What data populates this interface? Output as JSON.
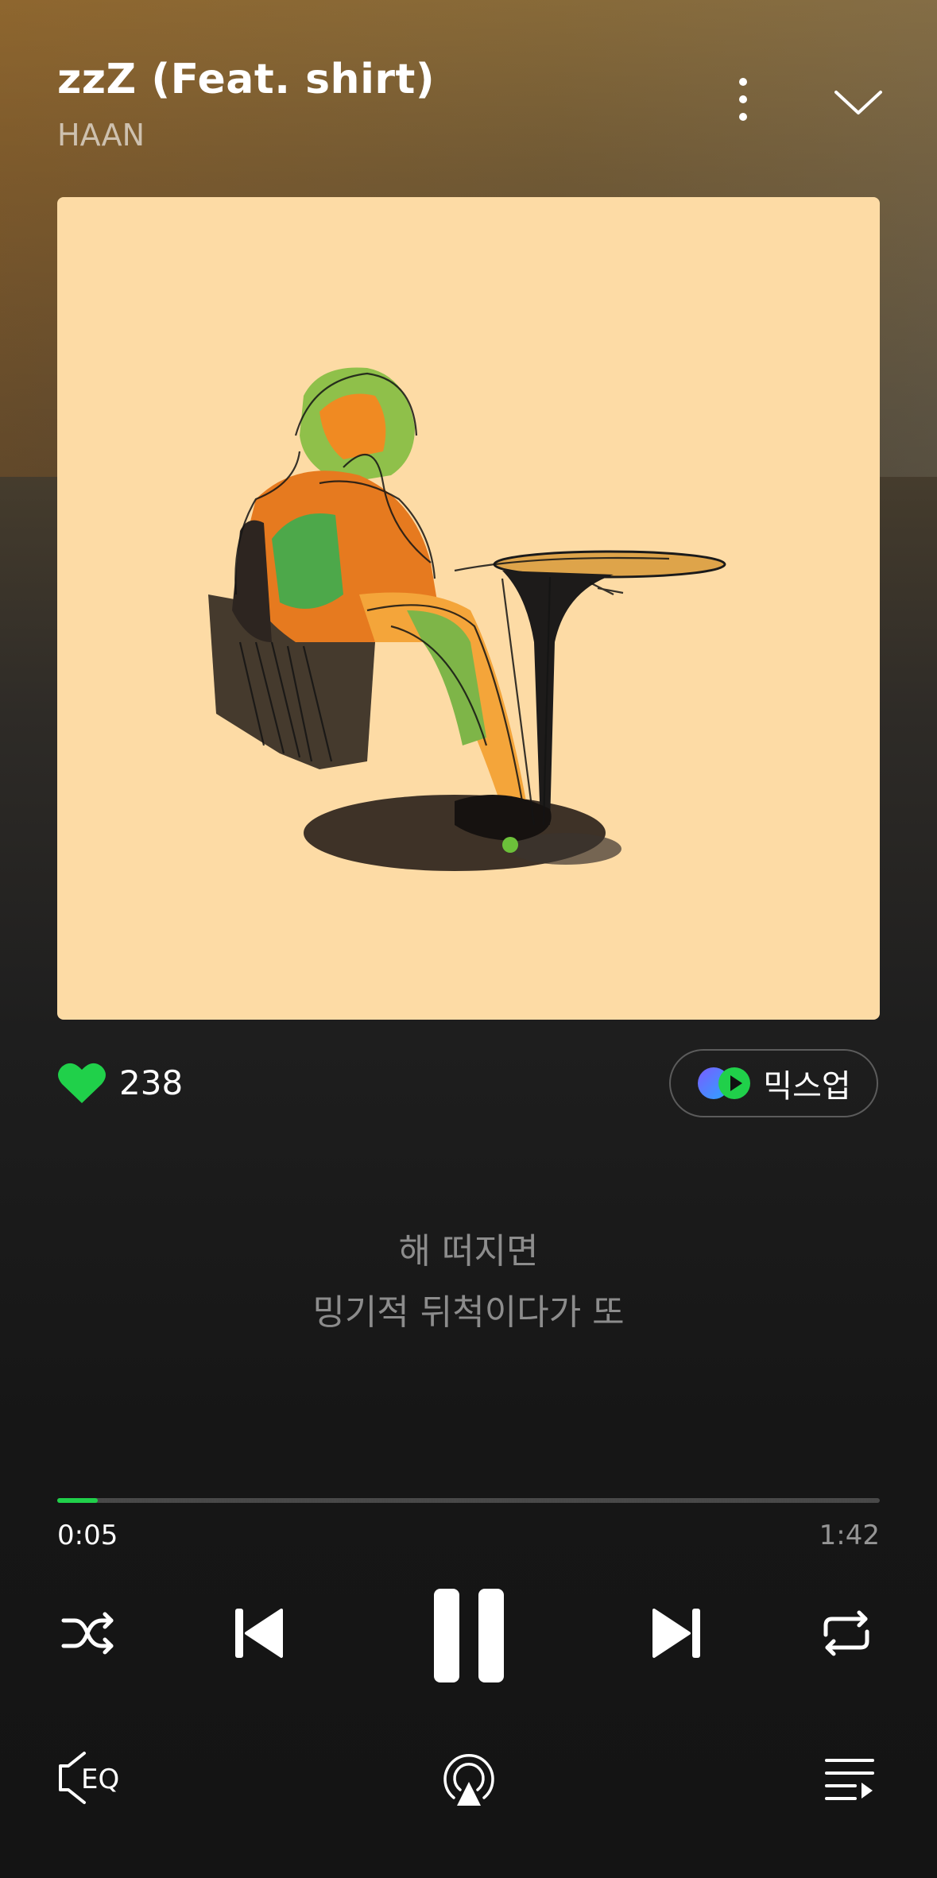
{
  "track": {
    "title": "zzZ (Feat. shirt)",
    "artist": "HAAN"
  },
  "like": {
    "count": "238",
    "color": "#20d04a"
  },
  "mixup": {
    "label": "믹스업"
  },
  "lyrics": {
    "line1": "해 떠지면",
    "line2": "밍기적 뒤척이다가 또"
  },
  "progress": {
    "current": "0:05",
    "total": "1:42",
    "fraction": 0.049
  },
  "controls": {
    "shuffle": "shuffle-icon",
    "previous": "previous-icon",
    "play_pause": "pause-icon",
    "next": "next-icon",
    "repeat": "repeat-icon"
  },
  "bottom_bar": {
    "eq_label": "EQ",
    "airplay": "airplay-icon",
    "playlist": "playlist-icon"
  },
  "colors": {
    "accent": "#20d04a",
    "album_bg": "#fddba5"
  }
}
